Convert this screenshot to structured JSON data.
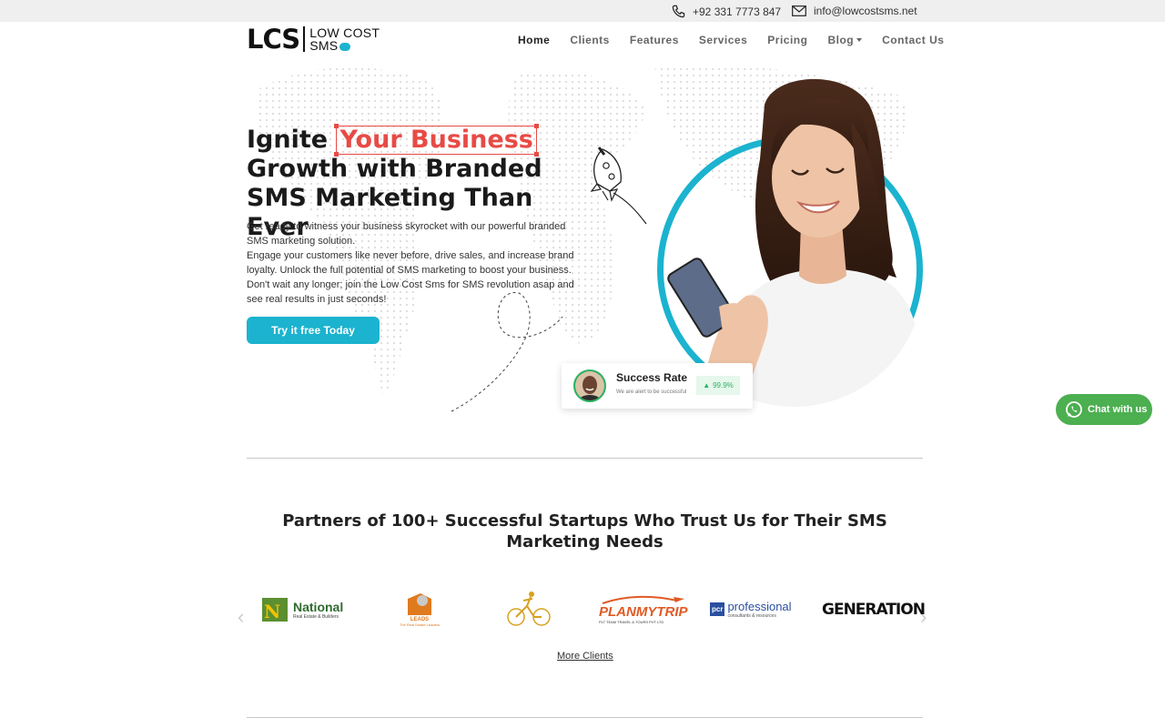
{
  "topbar": {
    "phone": "+92 331 7773 847",
    "email": "info@lowcostsms.net"
  },
  "brand": {
    "logo_mark": "LCS",
    "name_line1": "LOW COST",
    "name_line2": "SMS",
    "accent": "#1bb3cf"
  },
  "nav": {
    "items": [
      "Home",
      "Clients",
      "Features",
      "Services",
      "Pricing",
      "Blog",
      "Contact Us"
    ]
  },
  "hero": {
    "title_prefix": "Ignite ",
    "title_highlight": "Your Business",
    "title_rest": "Growth with Branded SMS Marketing Than Ever",
    "description": "Get ready to witness your business skyrocket with our powerful branded SMS marketing solution.\nEngage your customers like never before, drive sales, and increase brand loyalty. Unlock the full potential of SMS marketing to boost your business. Don't wait any longer; join the Low Cost Sms for SMS revolution asap and see real results in just seconds!",
    "cta_label": "Try it free Today",
    "highlight_color": "#e84a45"
  },
  "stat_card": {
    "title": "Success Rate",
    "subtitle": "We are alert to be successful",
    "value": "99.9%"
  },
  "whatsapp": {
    "label": "Chat with us"
  },
  "partners": {
    "title": "Partners of 100+ Successful Startups Who Trust Us for Their SMS Marketing Needs",
    "logos": [
      {
        "name": "National",
        "tagline": "Real Estate & Builders"
      },
      {
        "name": "LEADS",
        "tagline": "The Real Estate Leaders"
      },
      {
        "name": "",
        "tagline": ""
      },
      {
        "name": "PLANMYTRIP",
        "tagline": "PLT TEAM TRAVEL & TOURS PVT LTD"
      },
      {
        "name": "professional",
        "tagline": "consultants & resources"
      },
      {
        "name": "GENERATION",
        "tagline": ""
      }
    ],
    "more_label": "More Clients"
  }
}
